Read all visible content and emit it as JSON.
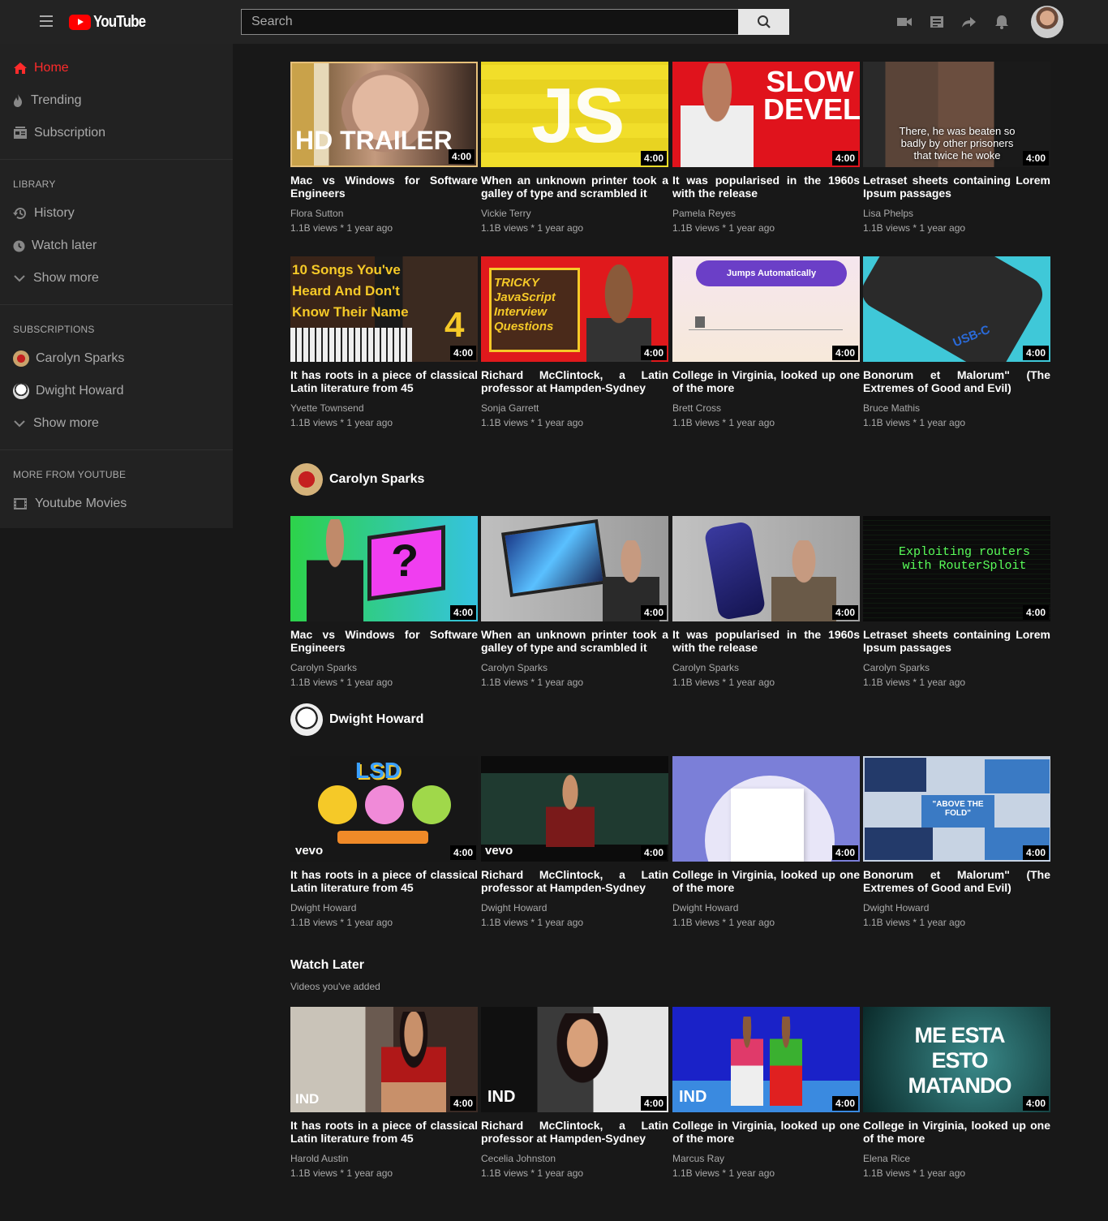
{
  "header": {
    "logo_text": "YouTube",
    "search_placeholder": "Search"
  },
  "sidebar": {
    "nav": [
      {
        "label": "Home",
        "icon": "home-icon",
        "active": true
      },
      {
        "label": "Trending",
        "icon": "flame-icon"
      },
      {
        "label": "Subscription",
        "icon": "subscriptions-icon"
      }
    ],
    "library_heading": "LIBRARY",
    "library": [
      {
        "label": "History",
        "icon": "history-icon"
      },
      {
        "label": "Watch later",
        "icon": "clock-icon"
      },
      {
        "label": "Show more",
        "icon": "chevron-down-icon"
      }
    ],
    "subscriptions_heading": "SUBSCRIPTIONS",
    "subscriptions": [
      {
        "label": "Carolyn Sparks"
      },
      {
        "label": "Dwight Howard"
      },
      {
        "label": "Show more"
      }
    ],
    "more_heading": "MORE FROM YOUTUBE",
    "more": [
      {
        "label": "Youtube Movies",
        "icon": "film-icon"
      }
    ]
  },
  "sections": {
    "carolyn": {
      "title": "Carolyn Sparks"
    },
    "dwight": {
      "title": "Dwight Howard"
    },
    "watch_later": {
      "title": "Watch Later",
      "subtitle": "Videos you've added"
    }
  },
  "videos": {
    "r1": [
      {
        "title": "Mac vs Windows for Software Engineers",
        "channel": "Flora Sutton",
        "meta": "1.1B views * 1 year ago",
        "duration": "4:00",
        "thumb_text": "HD TRAILER"
      },
      {
        "title": "When an unknown printer took a galley of type and scrambled it",
        "channel": "Vickie Terry",
        "meta": "1.1B views * 1 year ago",
        "duration": "4:00",
        "thumb_text": "JS"
      },
      {
        "title": "It was popularised in the 1960s with the release",
        "channel": "Pamela Reyes",
        "meta": "1.1B views * 1 year ago",
        "duration": "4:00",
        "thumb_text": "SLOW DEVELOPER"
      },
      {
        "title": "Letraset sheets containing Lorem Ipsum passages",
        "channel": "Lisa Phelps",
        "meta": "1.1B views * 1 year ago",
        "duration": "4:00",
        "thumb_text": "There, he was beaten so badly by other prisoners that twice he woke"
      }
    ],
    "r2": [
      {
        "title": "It has roots in a piece of classical Latin literature from 45",
        "channel": "Yvette Townsend",
        "meta": "1.1B views * 1 year ago",
        "duration": "4:00",
        "thumb_text": "10 Songs You've Heard And Don't Know Their Name"
      },
      {
        "title": "Richard McClintock, a Latin professor at Hampden-Sydney",
        "channel": "Sonja Garrett",
        "meta": "1.1B views * 1 year ago",
        "duration": "4:00",
        "thumb_text": "TRICKY JavaScript Interview Questions"
      },
      {
        "title": "College in Virginia, looked up one of the more",
        "channel": "Brett Cross",
        "meta": "1.1B views * 1 year ago",
        "duration": "4:00",
        "thumb_text": "Jumps Automatically"
      },
      {
        "title": "Bonorum et Malorum\" (The Extremes of Good and Evil)",
        "channel": "Bruce Mathis",
        "meta": "1.1B views * 1 year ago",
        "duration": "4:00",
        "thumb_text": "USB-C"
      }
    ],
    "r3": [
      {
        "title": "Mac vs Windows for Software Engineers",
        "channel": "Carolyn Sparks",
        "meta": "1.1B views * 1 year ago",
        "duration": "4:00",
        "thumb_text": "?"
      },
      {
        "title": "When an unknown printer took a galley of type and scrambled it",
        "channel": "Carolyn Sparks",
        "meta": "1.1B views * 1 year ago",
        "duration": "4:00",
        "thumb_text": ""
      },
      {
        "title": "It was popularised in the 1960s with the release",
        "channel": "Carolyn Sparks",
        "meta": "1.1B views * 1 year ago",
        "duration": "4:00",
        "thumb_text": ""
      },
      {
        "title": "Letraset sheets containing Lorem Ipsum passages",
        "channel": "Carolyn Sparks",
        "meta": "1.1B views * 1 year ago",
        "duration": "4:00",
        "thumb_text": "Exploiting routers with RouterSploit"
      }
    ],
    "r4": [
      {
        "title": "It has roots in a piece of classical Latin literature from 45",
        "channel": "Dwight Howard",
        "meta": "1.1B views * 1 year ago",
        "duration": "4:00",
        "thumb_text": "LSD"
      },
      {
        "title": "Richard McClintock, a Latin professor at Hampden-Sydney",
        "channel": "Dwight Howard",
        "meta": "1.1B views * 1 year ago",
        "duration": "4:00",
        "thumb_text": "vevo"
      },
      {
        "title": "College in Virginia, looked up one of the more",
        "channel": "Dwight Howard",
        "meta": "1.1B views * 1 year ago",
        "duration": "4:00",
        "thumb_text": ""
      },
      {
        "title": "Bonorum et Malorum\" (The Extremes of Good and Evil)",
        "channel": "Dwight Howard",
        "meta": "1.1B views * 1 year ago",
        "duration": "4:00",
        "thumb_text": "\"ABOVE THE FOLD\""
      }
    ],
    "r5": [
      {
        "title": "It has roots in a piece of classical Latin literature from 45",
        "channel": "Harold Austin",
        "meta": "1.1B views * 1 year ago",
        "duration": "4:00",
        "thumb_text": "IND"
      },
      {
        "title": "Richard McClintock, a Latin professor at Hampden-Sydney",
        "channel": "Cecelia Johnston",
        "meta": "1.1B views * 1 year ago",
        "duration": "4:00",
        "thumb_text": "IND"
      },
      {
        "title": "College in Virginia, looked up one of the more",
        "channel": "Marcus Ray",
        "meta": "1.1B views * 1 year ago",
        "duration": "4:00",
        "thumb_text": "IND"
      },
      {
        "title": "College in Virginia, looked up one of the more",
        "channel": "Elena Rice",
        "meta": "1.1B views * 1 year ago",
        "duration": "4:00",
        "thumb_text": "ME ESTA ESTO MATANDO"
      }
    ]
  },
  "colors": {
    "accent": "#ff0000",
    "background": "#181818",
    "sidebar": "#222222",
    "header": "#232323"
  }
}
